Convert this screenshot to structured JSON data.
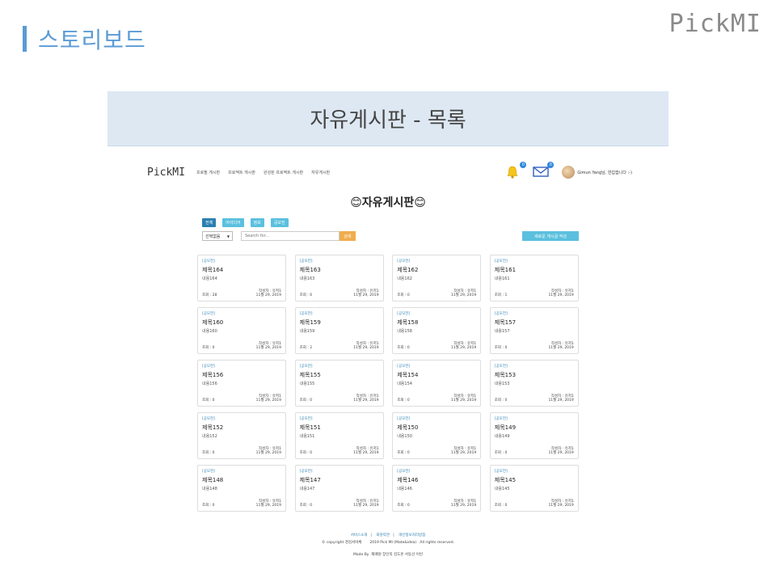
{
  "slide": {
    "title": "스토리보드",
    "logo": "PickMI"
  },
  "banner": {
    "title": "자유게시판 - 목록"
  },
  "nav": {
    "brand": "PickMI",
    "menu": [
      "프로필 게시판",
      "프로젝트 게시판",
      "완성된 프로젝트 게시판",
      "자유게시판"
    ],
    "bell_badge": "0",
    "mail_badge": "0",
    "greeting": "Gimun Yang님, 반갑습니다 :-)"
  },
  "board": {
    "title": "😊자유게시판😊",
    "tabs": [
      "전체",
      "아이디어",
      "정보",
      "공모전"
    ],
    "select_value": "선택없음",
    "search_placeholder": "Search for...",
    "search_button": "검색",
    "write_button": "새로운 게시글 작성"
  },
  "posts": [
    {
      "category": "[공모전]",
      "title": "제목164",
      "content": "내용164",
      "author": "작성자 : 유저1",
      "views": "조회 : 28",
      "date": "11월 29, 2019"
    },
    {
      "category": "[공모전]",
      "title": "제목163",
      "content": "내용163",
      "author": "작성자 : 유저1",
      "views": "조회 : 6",
      "date": "11월 29, 2019"
    },
    {
      "category": "[공모전]",
      "title": "제목162",
      "content": "내용162",
      "author": "작성자 : 유저1",
      "views": "조회 : 0",
      "date": "11월 29, 2019"
    },
    {
      "category": "[공모전]",
      "title": "제목161",
      "content": "내용161",
      "author": "작성자 : 유저1",
      "views": "조회 : 1",
      "date": "11월 29, 2019"
    },
    {
      "category": "[공모전]",
      "title": "제목160",
      "content": "내용160",
      "author": "작성자 : 유저1",
      "views": "조회 : 0",
      "date": "11월 29, 2019"
    },
    {
      "category": "[공모전]",
      "title": "제목159",
      "content": "내용159",
      "author": "작성자 : 유저1",
      "views": "조회 : 2",
      "date": "11월 29, 2019"
    },
    {
      "category": "[공모전]",
      "title": "제목158",
      "content": "내용158",
      "author": "작성자 : 유저1",
      "views": "조회 : 0",
      "date": "11월 29, 2019"
    },
    {
      "category": "[공모전]",
      "title": "제목157",
      "content": "내용157",
      "author": "작성자 : 유저1",
      "views": "조회 : 0",
      "date": "11월 29, 2019"
    },
    {
      "category": "[공모전]",
      "title": "제목156",
      "content": "내용156",
      "author": "작성자 : 유저1",
      "views": "조회 : 0",
      "date": "11월 29, 2019"
    },
    {
      "category": "[공모전]",
      "title": "제목155",
      "content": "내용155",
      "author": "작성자 : 유저1",
      "views": "조회 : 0",
      "date": "11월 29, 2019"
    },
    {
      "category": "[공모전]",
      "title": "제목154",
      "content": "내용154",
      "author": "작성자 : 유저1",
      "views": "조회 : 0",
      "date": "11월 29, 2019"
    },
    {
      "category": "[공모전]",
      "title": "제목153",
      "content": "내용153",
      "author": "작성자 : 유저1",
      "views": "조회 : 0",
      "date": "11월 29, 2019"
    },
    {
      "category": "[공모전]",
      "title": "제목152",
      "content": "내용152",
      "author": "작성자 : 유저1",
      "views": "조회 : 0",
      "date": "11월 29, 2019"
    },
    {
      "category": "[공모전]",
      "title": "제목151",
      "content": "내용151",
      "author": "작성자 : 유저1",
      "views": "조회 : 0",
      "date": "11월 29, 2019"
    },
    {
      "category": "[공모전]",
      "title": "제목150",
      "content": "내용150",
      "author": "작성자 : 유저1",
      "views": "조회 : 0",
      "date": "11월 29, 2019"
    },
    {
      "category": "[공모전]",
      "title": "제목149",
      "content": "내용149",
      "author": "작성자 : 유저1",
      "views": "조회 : 0",
      "date": "11월 29, 2019"
    },
    {
      "category": "[공모전]",
      "title": "제목148",
      "content": "내용148",
      "author": "작성자 : 유저1",
      "views": "조회 : 0",
      "date": "11월 29, 2019"
    },
    {
      "category": "[공모전]",
      "title": "제목147",
      "content": "내용147",
      "author": "작성자 : 유저1",
      "views": "조회 : 0",
      "date": "11월 29, 2019"
    },
    {
      "category": "[공모전]",
      "title": "제목146",
      "content": "내용146",
      "author": "작성자 : 유저1",
      "views": "조회 : 0",
      "date": "11월 29, 2019"
    },
    {
      "category": "[공모전]",
      "title": "제목145",
      "content": "내용145",
      "author": "작성자 : 유저1",
      "views": "조회 : 0",
      "date": "11월 29, 2019"
    }
  ],
  "footer": {
    "links": [
      "서비스소개",
      "회원약관",
      "개인정보처리방침"
    ],
    "copyright": "© copyright 경김서비체       2019 Pick MI (Mate&idea)   All rights reserved.",
    "made_by": "Made By  재배원 장인묵 김도훈 서동선 이빈"
  },
  "colors": {
    "accent": "#5b9bd5",
    "tab": "#5bc0de",
    "tab_active": "#2a7fb0",
    "search_button": "#f0ad4e",
    "banner": "#dde8f3"
  }
}
